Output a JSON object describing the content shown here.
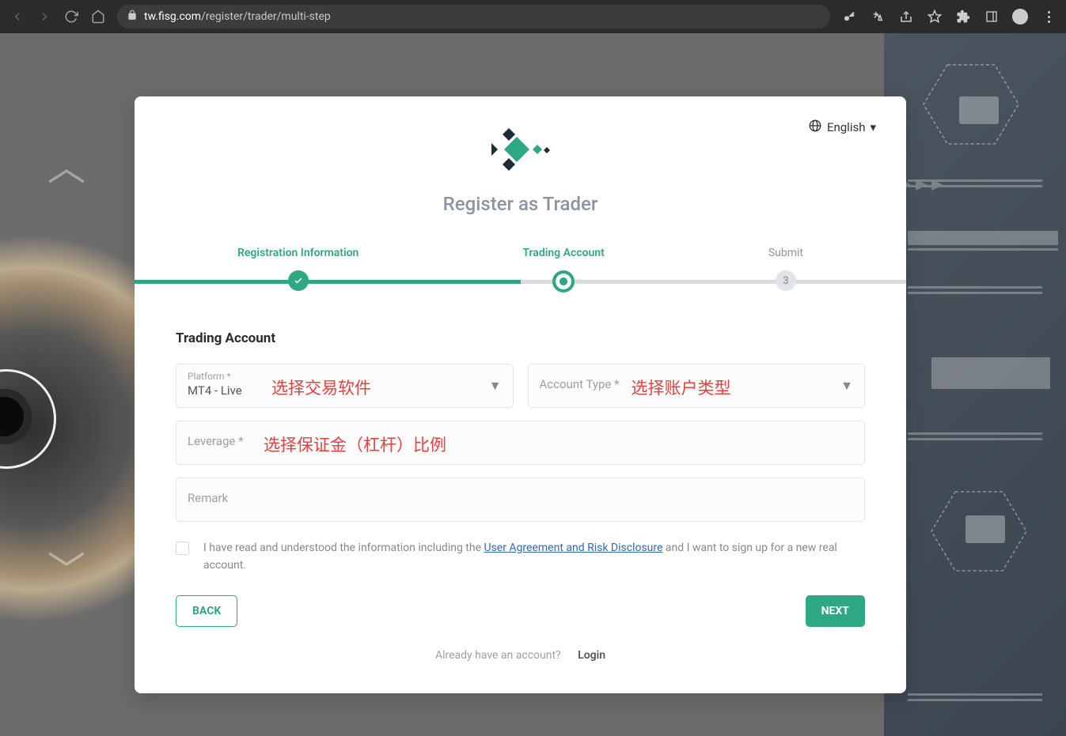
{
  "browser": {
    "url_host": "tw.fisg.com",
    "url_path": "/register/trader/multi-step"
  },
  "lang": {
    "label": "English"
  },
  "page_title": "Register as Trader",
  "stepper": {
    "s1": "Registration Information",
    "s2": "Trading Account",
    "s3": "Submit",
    "s3_num": "3"
  },
  "section_title": "Trading Account",
  "fields": {
    "platform_label": "Platform *",
    "platform_value": "MT4 - Live",
    "account_type_label": "Account Type *",
    "leverage_label": "Leverage *",
    "remark_label": "Remark"
  },
  "annotations": {
    "platform": "选择交易软件",
    "account_type": "选择账户类型",
    "leverage": "选择保证金（杠杆）比例"
  },
  "consent": {
    "pre": "I have read and understood the information including the ",
    "link": "User Agreement and Risk Disclosure",
    "post": " and I want to sign up for a new real account."
  },
  "buttons": {
    "back": "BACK",
    "next": "NEXT"
  },
  "footer": {
    "prompt": "Already have an account?",
    "login": "Login"
  }
}
